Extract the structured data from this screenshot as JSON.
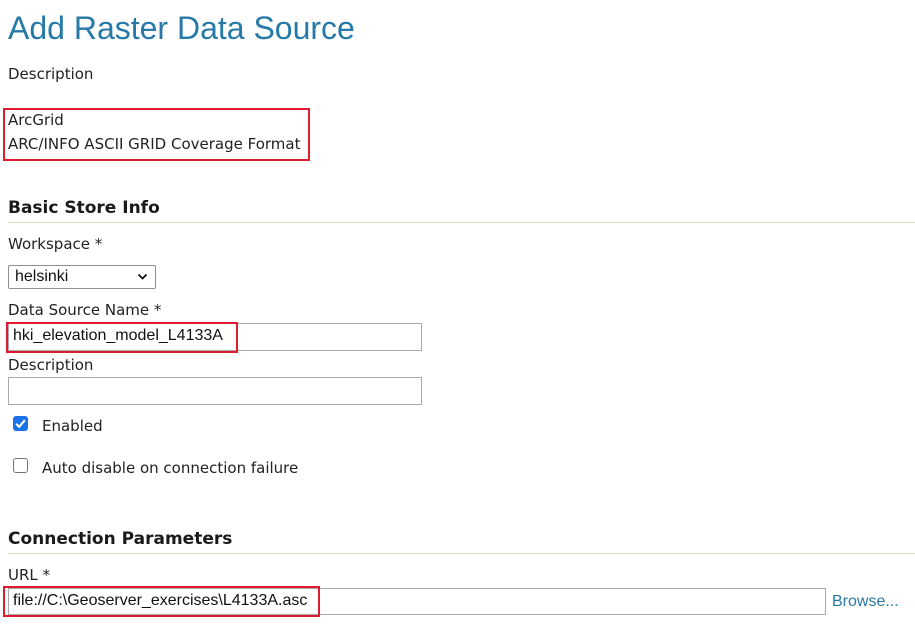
{
  "page": {
    "title": "Add Raster Data Source"
  },
  "description_block": {
    "heading": "Description",
    "store_type": "ArcGrid",
    "store_format": "ARC/INFO ASCII GRID Coverage Format"
  },
  "basic_store_info": {
    "heading": "Basic Store Info",
    "workspace_label": "Workspace *",
    "workspace_value": "helsinki",
    "name_label": "Data Source Name *",
    "name_value": "hki_elevation_model_L4133A",
    "description_label": "Description",
    "description_value": "",
    "enabled_label": "Enabled",
    "enabled_checked": true,
    "auto_disable_label": "Auto disable on connection failure",
    "auto_disable_checked": false
  },
  "connection_parameters": {
    "heading": "Connection Parameters",
    "url_label": "URL *",
    "url_value": "file://C:\\Geoserver_exercises\\L4133A.asc",
    "browse_label": "Browse..."
  },
  "colors": {
    "accent": "#2779a7",
    "highlight_box": "#e01b2f",
    "checkbox": "#1a73e8"
  }
}
